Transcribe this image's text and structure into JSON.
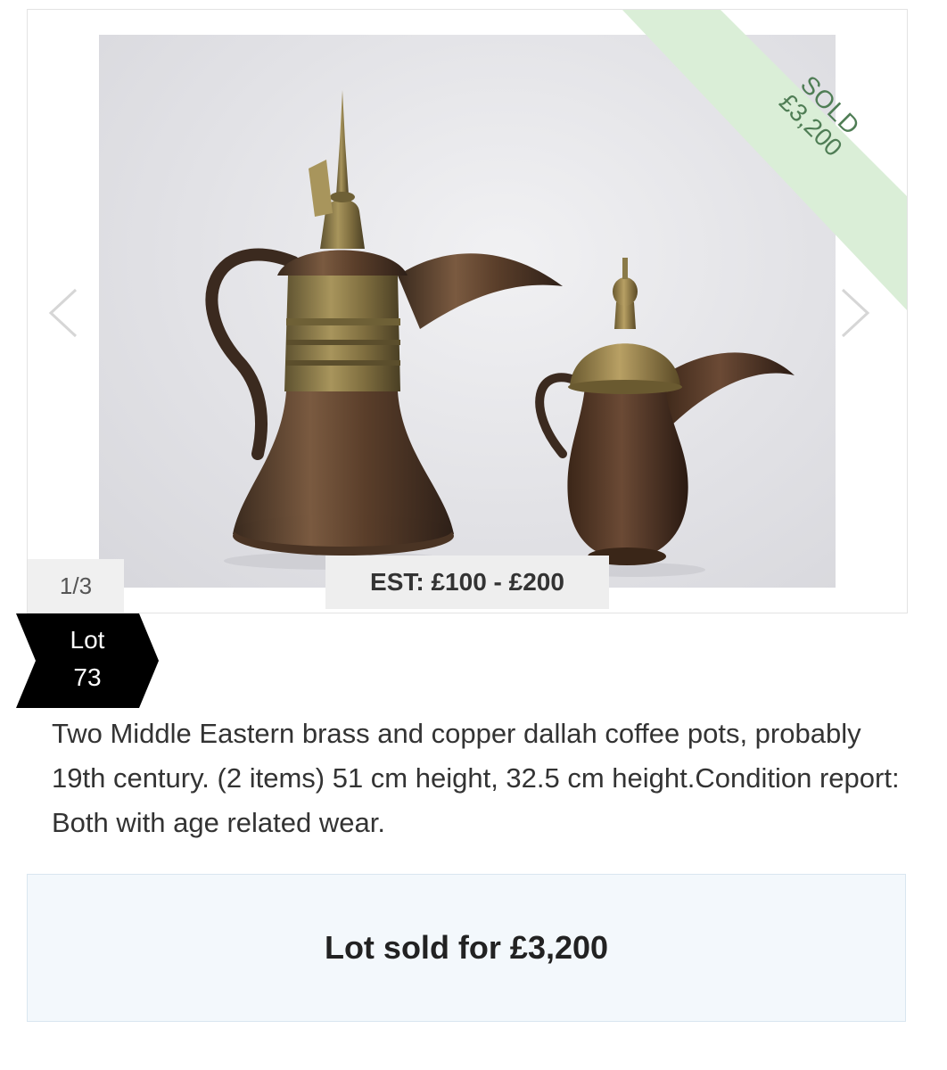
{
  "gallery": {
    "counter": "1/3",
    "estimate": "EST: £100 - £200",
    "prev_icon": "chevron-left-icon",
    "next_icon": "chevron-right-icon",
    "image_subject": "two brass and copper dallah coffee pots"
  },
  "ribbon": {
    "status": "SOLD",
    "price": "£3,200",
    "color": "#daeed7",
    "text_color": "#4f7d55"
  },
  "lot": {
    "label": "Lot",
    "number": "73"
  },
  "description": "Two Middle Eastern brass and copper dallah coffee pots, probably 19th century. (2 items) 51 cm height, 32.5 cm height.Condition report: Both with age related wear.",
  "result": {
    "text": "Lot sold for £3,200"
  }
}
